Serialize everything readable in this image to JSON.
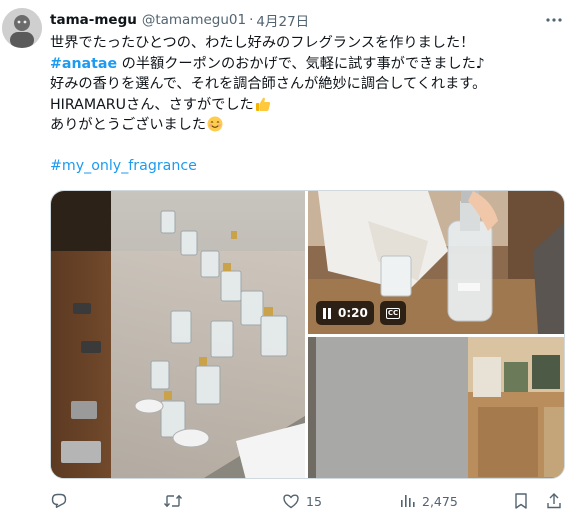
{
  "tweet": {
    "display_name": "tama-megu",
    "handle": "@tamamegu01",
    "separator": "·",
    "date": "4月27日",
    "lines": {
      "l1": "世界でたったひとつの、わたし好みのフレグランスを作りました！",
      "l2_tag": "#anatae",
      "l2_rest": " の半額クーポンのおかげで、気軽に試す事ができました♪",
      "l3": "好みの香りを選んで、それを調合師さんが絶妙に調合してくれます。",
      "l4": " HIRAMARUさん、さすがでした",
      "l5": "ありがとうございました",
      "hashtag": "#my_only_fragrance"
    },
    "emojis": {
      "l4": "thumbs-up-emoji",
      "l5": "smiling-face-emoji"
    }
  },
  "media": {
    "video_time": "0:20",
    "cc_label": "CC"
  },
  "actions": {
    "reply_icon": "reply-icon",
    "retweet_icon": "retweet-icon",
    "like_icon": "heart-icon",
    "like_count": "15",
    "views_icon": "views-bar-chart-icon",
    "views_count": "2,475",
    "bookmark_icon": "bookmark-icon",
    "share_icon": "share-icon"
  },
  "colors": {
    "link": "#1d9bf0",
    "text": "#0f1419",
    "muted": "#536471"
  }
}
